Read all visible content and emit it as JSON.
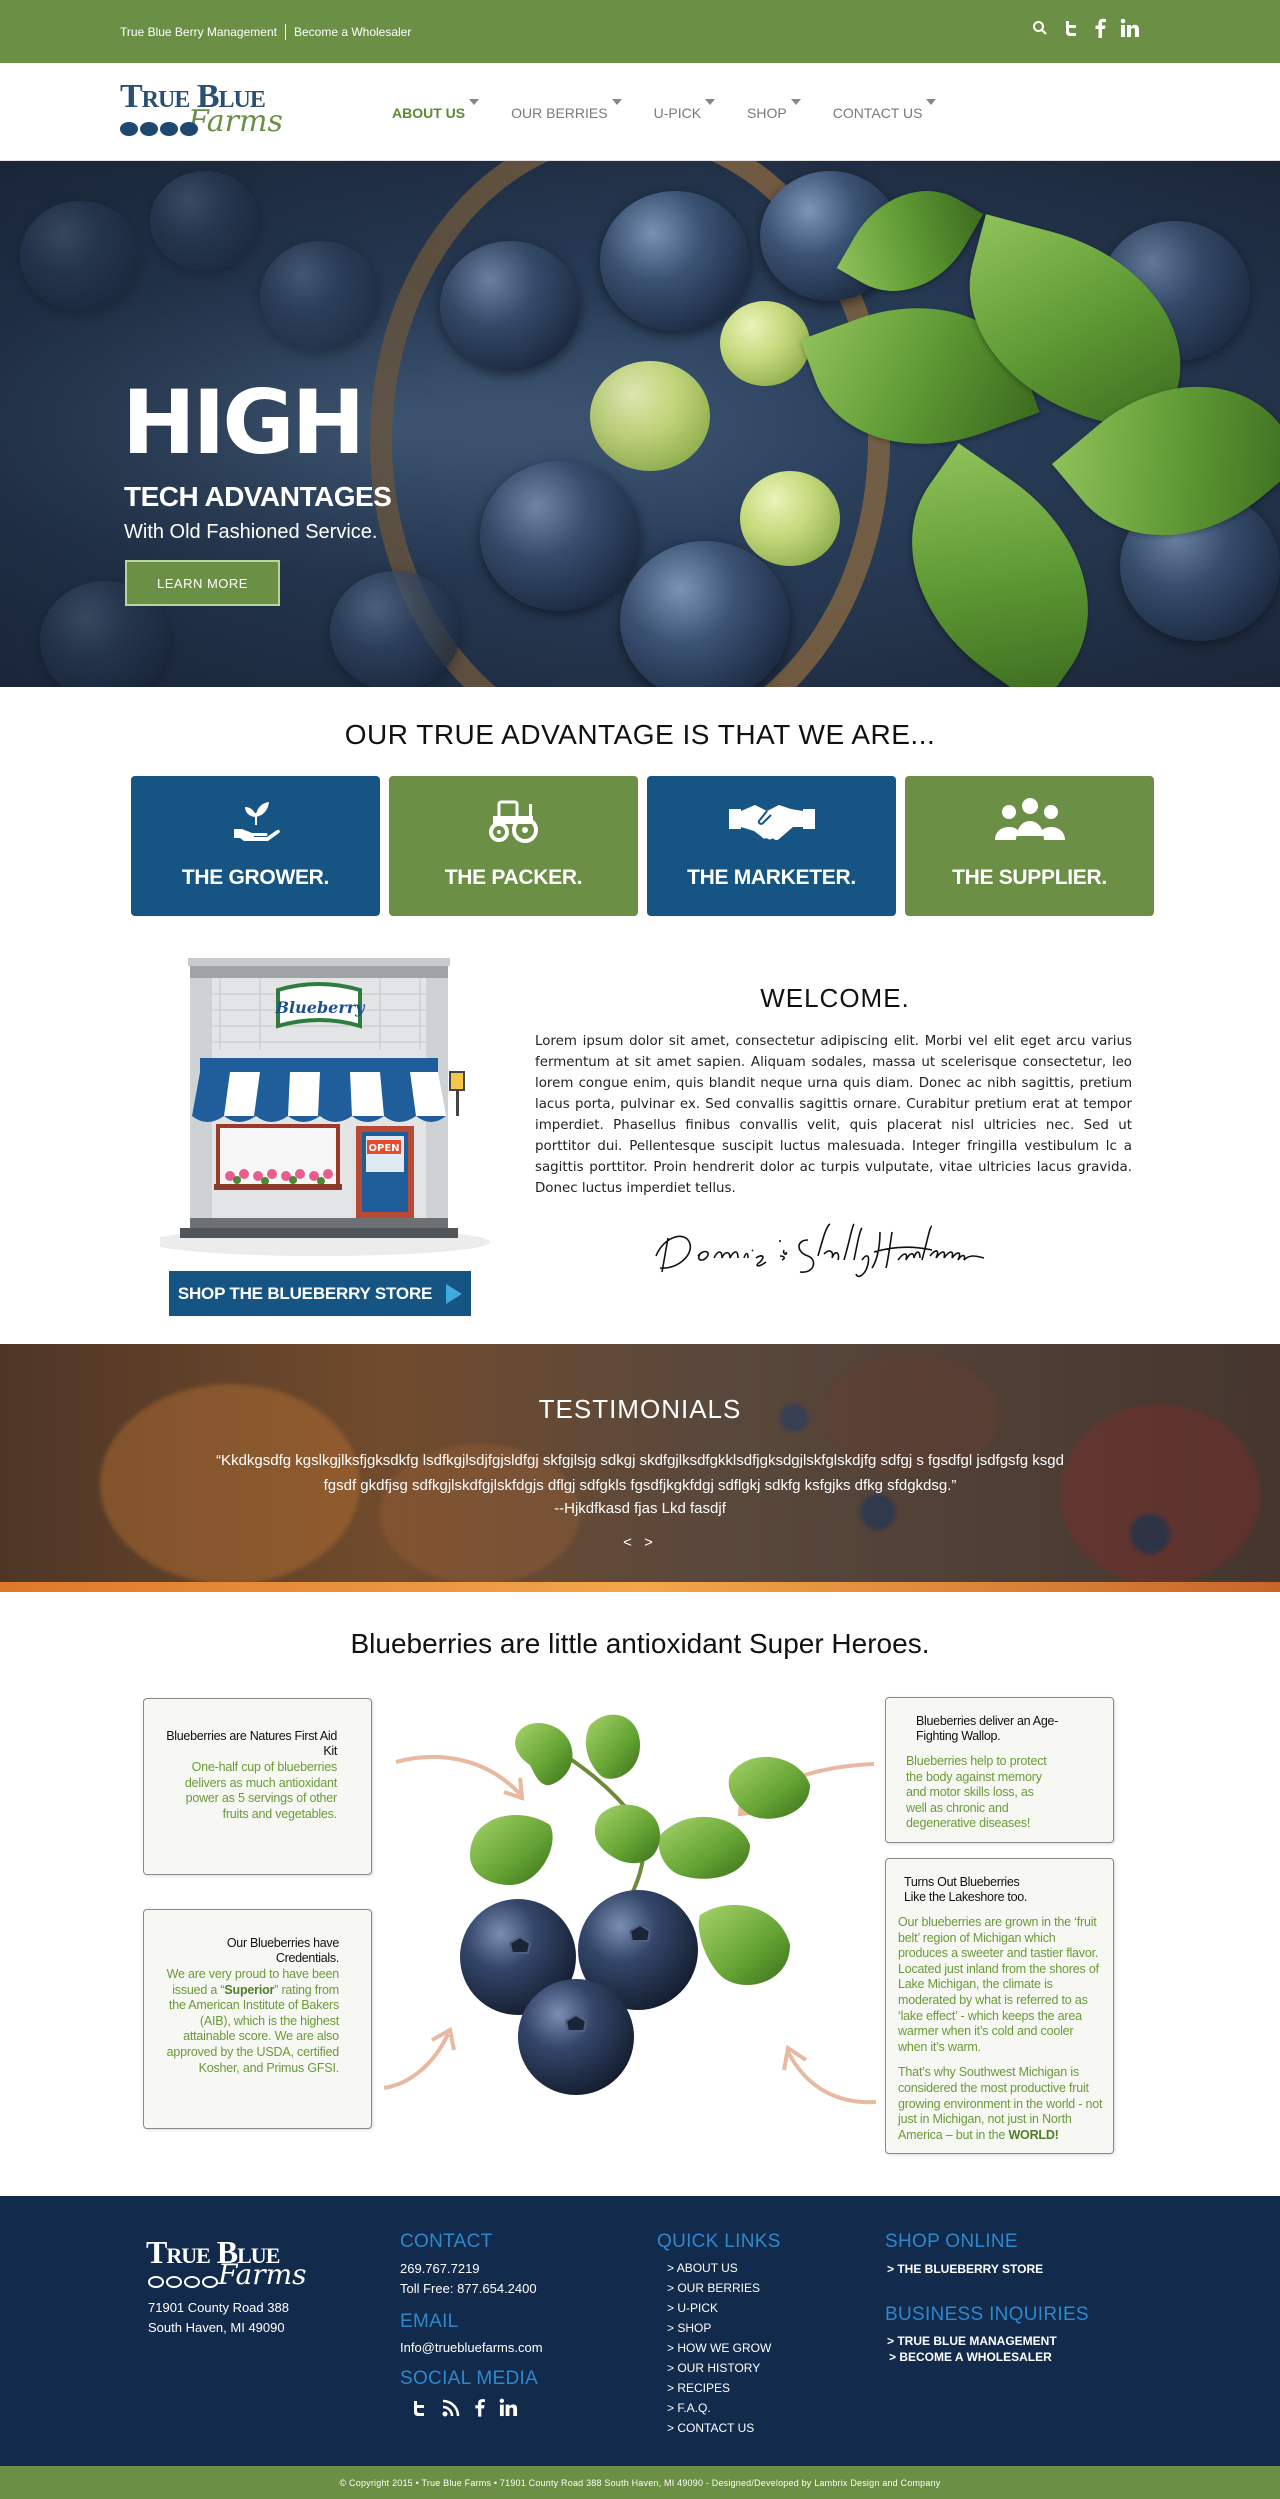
{
  "topbar": {
    "link_management": "True Blue Berry Management",
    "link_wholesaler": "Become a Wholesaler",
    "icons": [
      "search-icon",
      "twitter-icon",
      "facebook-icon",
      "linkedin-icon"
    ],
    "background": "#6a8f45"
  },
  "logo": {
    "line1": "True Blue",
    "line2": "Farms"
  },
  "nav": {
    "items": [
      {
        "label": "ABOUT US",
        "active": true
      },
      {
        "label": "OUR BERRIES",
        "active": false
      },
      {
        "label": "U-PICK",
        "active": false
      },
      {
        "label": "SHOP",
        "active": false
      },
      {
        "label": "CONTACT US",
        "active": false
      }
    ]
  },
  "hero": {
    "headline": "HIGH",
    "subhead": "TECH ADVANTAGES",
    "tagline": "With Old Fashioned Service.",
    "button": "LEARN MORE"
  },
  "advantage": {
    "title": "OUR TRUE ADVANTAGE IS THAT WE ARE...",
    "tiles": [
      {
        "label": "THE GROWER.",
        "icon": "plant-hand-icon",
        "color": "#165583"
      },
      {
        "label": "THE PACKER.",
        "icon": "tractor-icon",
        "color": "#6a8f45"
      },
      {
        "label": "THE MARKETER.",
        "icon": "handshake-icon",
        "color": "#165583"
      },
      {
        "label": "THE SUPPLIER.",
        "icon": "people-icon",
        "color": "#6a8f45"
      }
    ]
  },
  "store": {
    "sign": "Blueberry",
    "open_sign": "OPEN",
    "button": "SHOP THE BLUEBERRY STORE"
  },
  "welcome": {
    "title": "WELCOME.",
    "body": "Lorem ipsum dolor sit amet, consectetur adipiscing elit. Morbi vel elit eget arcu varius fermentum at sit amet sapien. Aliquam sodales, massa ut scelerisque consectetur, leo lorem congue enim, quis blandit neque urna quis diam. Donec ac nibh sagittis, pretium lacus porta, pulvinar ex. Sed convallis sagittis ornare. Curabitur pretium erat at tempor imperdiet. Phasellus finibus convallis velit, quis placerat nisl ultricies nec. Sed ut porttitor dui. Pellentesque suscipit luctus malesuada. Integer fringilla vestibulum lc a sagittis porttitor. Proin hendrerit dolor ac turpis vulputate, vitae ultricies lacus gravida. Donec luctus imperdiet tellus.",
    "signature": "Dennis & Shelly Hartmann"
  },
  "testimonials": {
    "title": "TESTIMONIALS",
    "quote": "“Kkdkgsdfg kgslkgjlksfjgksdkfg lsdfkgjlsdjfgjsldfgj skfgjlsjg sdkgj skdfgjlksdfgkklsdfjgksdgjlskfglskdjfg sdfgj  s fgsdfgl jsdfgsfg ksgd fgsdf gkdfjsg sdfkgjlskdfgjlskfdgjs dflgj sdfgkls fgsdfjkgkfdgj sdflgkj sdkfg ksfgjks dfkg sfdgkdsg.”",
    "author": "--Hjkdfkasd fjas Lkd fasdjf",
    "prev": "<",
    "next": ">"
  },
  "superheroes": {
    "title": "Blueberries are little antioxidant Super Heroes.",
    "facts": [
      {
        "title": "Blueberries are Natures First Aid Kit",
        "body": "One-half cup of blueberries delivers as much antioxidant power as 5 servings of other fruits and vegetables."
      },
      {
        "title": "Our Blueberries have Credentials.",
        "body_pre": "We are very proud to have been issued a “",
        "body_strong": "Superior",
        "body_post": "” rating from the American Institute of Bakers (AIB), which is the highest attainable score. We are also approved by the USDA, certified Kosher, and Primus GFSI."
      },
      {
        "title": "Blueberries deliver an Age-Fighting Wallop.",
        "body": "Blueberries help to protect the body against memory and motor skills loss, as well as chronic and degenerative diseases!"
      },
      {
        "title": "Turns Out Blueberries Like the Lakeshore too.",
        "body": "Our blueberries are grown in the ‘fruit belt’ region of Michigan which produces a sweeter and tastier flavor. Located just inland from the shores of Lake Michigan, the climate is moderated by what is referred to as ‘lake effect’ - which keeps the area warmer when it’s cold and cooler when it’s warm.",
        "body2_pre": "That’s why Southwest Michigan is considered the most productive fruit growing environment in the world - not just in Michigan, not just in North America – but in the ",
        "body2_strong": "WORLD!"
      }
    ]
  },
  "footer": {
    "logo_line1": "True Blue",
    "logo_line2": "Farms",
    "address_line1": "71901 County Road 388",
    "address_line2": "South Haven, MI 49090",
    "contact_heading": "CONTACT",
    "phone": "269.767.7219",
    "toll_free": "Toll Free: 877.654.2400",
    "email_heading": "EMAIL",
    "email": "Info@truebluefarms.com",
    "social_heading": "SOCIAL MEDIA",
    "social_icons": [
      "twitter-icon",
      "rss-icon",
      "facebook-icon",
      "linkedin-icon"
    ],
    "quick_links_heading": "QUICK LINKS",
    "quick_links": [
      "ABOUT US",
      "OUR BERRIES",
      "U-PICK",
      "SHOP",
      "HOW WE GROW",
      "OUR HISTORY",
      "RECIPES",
      "F.A.Q.",
      "CONTACT US"
    ],
    "shop_heading": "SHOP ONLINE",
    "shop_links": [
      "THE BLUEBERRY STORE"
    ],
    "business_heading": "BUSINESS INQUIRIES",
    "business_links": [
      "TRUE BLUE MANAGEMENT",
      "BECOME A WHOLESALER"
    ],
    "copyright": "© Copyright 2015  •  True Blue Farms  •  71901 County Road 388 South Haven, MI 49090 - Designed/Developed by Lambrix Design and Company"
  }
}
